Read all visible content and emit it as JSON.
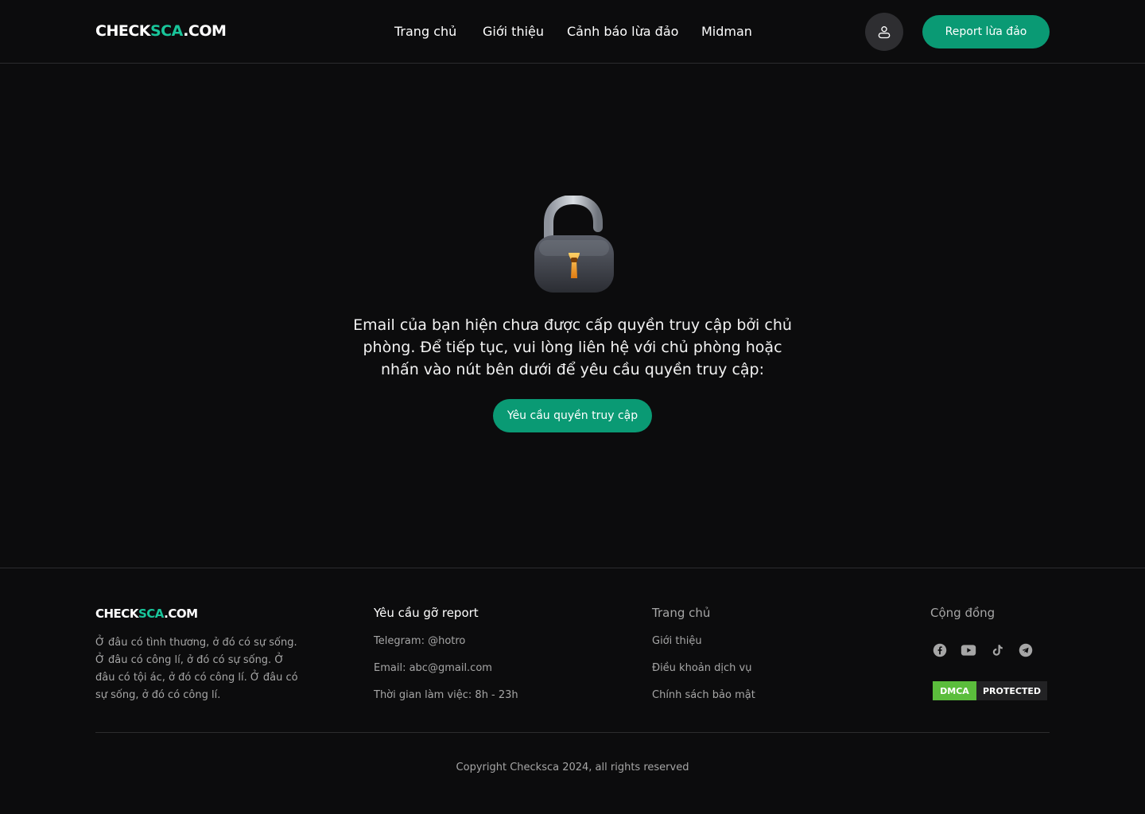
{
  "header": {
    "logo_main": "CHECK",
    "logo_accent": "SCA",
    "logo_suffix": ".COM",
    "nav": [
      "Trang chủ",
      "Giới thiệu",
      "Cảnh báo lừa đảo",
      "Midman"
    ],
    "user_icon": "user-icon",
    "report_label": "Report lừa đảo"
  },
  "main": {
    "lock_icon": "lock-icon",
    "message": "Email của bạn hiện chưa được cấp quyền truy cập bởi chủ phòng. Để tiếp tục, vui lòng liên hệ với chủ phòng hoặc nhấn vào nút bên dưới để yêu cầu quyền truy cập:",
    "request_label": "Yêu cầu quyền truy cập"
  },
  "footer": {
    "logo_main": "CHECK",
    "logo_accent": "SCA",
    "logo_suffix": ".COM",
    "description": "Ở đâu có tình thương, ở đó có sự sống. Ở đâu có công lí, ở đó có sự sống. Ở đâu có tội ác, ở đó có công lí. Ở đâu có sự sống, ở đó có công lí.",
    "col1": {
      "title": "Yêu cầu gỡ report",
      "items": [
        "Telegram: @hotro",
        "Email: abc@gmail.com",
        "Thời gian làm việc: 8h - 23h"
      ]
    },
    "col2": {
      "title": "Trang chủ",
      "items": [
        "Giới thiệu",
        "Điều khoản dịch vụ",
        "Chính sách bảo mật"
      ]
    },
    "col3": {
      "title": "Cộng đồng",
      "socials": [
        "facebook-icon",
        "youtube-icon",
        "tiktok-icon",
        "telegram-icon"
      ],
      "dmca_left": "DMCA",
      "dmca_right": "PROTECTED"
    },
    "copyright": "Copyright Checksca 2024, all rights reserved"
  },
  "colors": {
    "background": "#0c0c0d",
    "accent": "#19c59a",
    "button": "#0a9a74",
    "muted_text": "#a6a6a6"
  }
}
